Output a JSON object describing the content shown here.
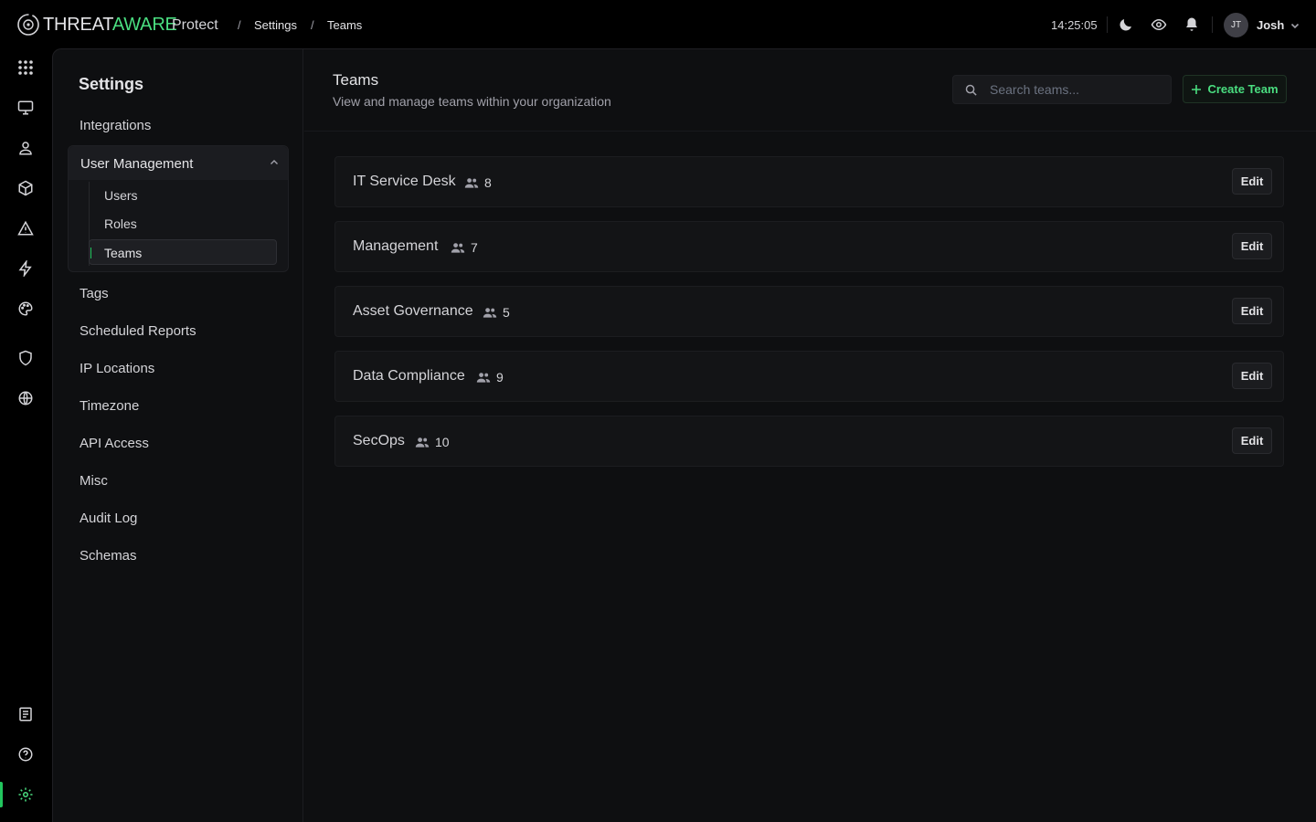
{
  "brand": {
    "part1": "THREAT",
    "part2": "AWARE",
    "product": "Protect",
    "accent": "#4ade80"
  },
  "breadcrumb": {
    "sep": "/",
    "items": [
      "Settings",
      "Teams"
    ]
  },
  "header": {
    "clock": "14:25:05",
    "user_initials": "JT",
    "user_name": "Josh"
  },
  "rail": {
    "top_icons": [
      "grid-icon",
      "monitor-icon",
      "user-icon",
      "cube-icon",
      "warning-icon",
      "bolt-icon",
      "palette-icon",
      "shield-icon",
      "globe-icon"
    ],
    "bottom_icons": [
      "book-icon",
      "help-icon",
      "gear-icon"
    ]
  },
  "subnav": {
    "title": "Settings",
    "integrations": "Integrations",
    "group": {
      "label": "User Management",
      "items": [
        "Users",
        "Roles",
        "Teams"
      ],
      "active": "Teams"
    },
    "items": [
      "Tags",
      "Scheduled Reports",
      "IP Locations",
      "Timezone",
      "API Access",
      "Misc",
      "Audit Log",
      "Schemas"
    ]
  },
  "page": {
    "title": "Teams",
    "subtitle": "View and manage teams within your organization",
    "search_placeholder": "Search teams...",
    "create_label": "Create Team"
  },
  "teams": [
    {
      "name": "IT Service Desk",
      "count": "8",
      "edit": "Edit"
    },
    {
      "name": "Management",
      "count": "7",
      "edit": "Edit"
    },
    {
      "name": "Asset Governance",
      "count": "5",
      "edit": "Edit"
    },
    {
      "name": "Data Compliance",
      "count": "9",
      "edit": "Edit"
    },
    {
      "name": "SecOps",
      "count": "10",
      "edit": "Edit"
    }
  ]
}
